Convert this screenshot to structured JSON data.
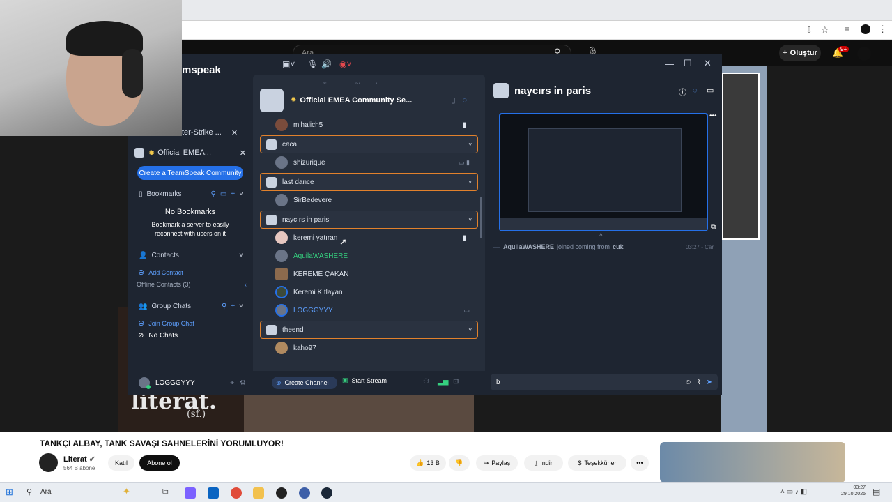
{
  "youtube": {
    "search_placeholder": "Ara",
    "create_label": "Oluştur",
    "notif_badge": "9+",
    "video_title": "TANKÇI ALBAY, TANK SAVAŞI SAHNELERİNİ YORUMLUYOR!",
    "channel_name": "Literat",
    "channel_subs": "564 B abone",
    "join_label": "Katıl",
    "subscribe_label": "Abone ol",
    "likes": "13 B",
    "share_label": "Paylaş",
    "download_label": "İndir",
    "thanks_label": "Teşekkürler",
    "overlay_logo": "literat.",
    "overlay_sub": "(sf.)"
  },
  "teamspeak": {
    "logo_text": "mspeak",
    "left": {
      "server_tab_1": "ter-Strike ...",
      "server_tab_2": "Official EMEA...",
      "create_community": "Create a TeamSpeak Community",
      "bookmarks_label": "Bookmarks",
      "no_bookmarks": "No Bookmarks",
      "bookmark_hint": "Bookmark a server to easily reconnect with users on it",
      "contacts_label": "Contacts",
      "add_contact": "Add Contact",
      "offline_contacts": "Offline Contacts (3)",
      "group_chats_label": "Group Chats",
      "join_group_chat": "Join Group Chat",
      "no_chats": "No Chats",
      "username": "LOGGGYYY"
    },
    "middle": {
      "temp_channels": "Temporary Channels",
      "server_name": "Official EMEA Community Se...",
      "rows": [
        {
          "type": "user",
          "name": "mihalich5"
        },
        {
          "type": "channel",
          "name": "caca"
        },
        {
          "type": "user",
          "name": "shizurique"
        },
        {
          "type": "channel",
          "name": "last dance"
        },
        {
          "type": "user",
          "name": "SirBedevere"
        },
        {
          "type": "channel",
          "name": "naycırs in paris"
        },
        {
          "type": "user",
          "name": "keremi yatıran"
        },
        {
          "type": "user",
          "name": "AquilaWASHERE"
        },
        {
          "type": "user",
          "name": "KEREME ÇAKAN"
        },
        {
          "type": "user",
          "name": "Keremi Kıtlayan"
        },
        {
          "type": "user",
          "name": "LOGGGYYY"
        },
        {
          "type": "channel",
          "name": "theend"
        },
        {
          "type": "user",
          "name": "kaho97"
        }
      ],
      "create_channel": "Create Channel",
      "start_stream": "Start Stream"
    },
    "right": {
      "channel_title": "naycırs in paris",
      "join_user": "AquilaWASHERE",
      "join_text": "joined coming from",
      "join_from": "cuk",
      "join_time": "03:27 - Çar",
      "message_input": "b"
    }
  },
  "taskbar": {
    "search_label": "Ara",
    "time": "03:27",
    "date": "29.10.2025"
  },
  "colors": {
    "ts_bg": "#1e2531",
    "accent_orange": "#e1812c",
    "accent_blue": "#2570e8",
    "online_green": "#35d07f"
  }
}
